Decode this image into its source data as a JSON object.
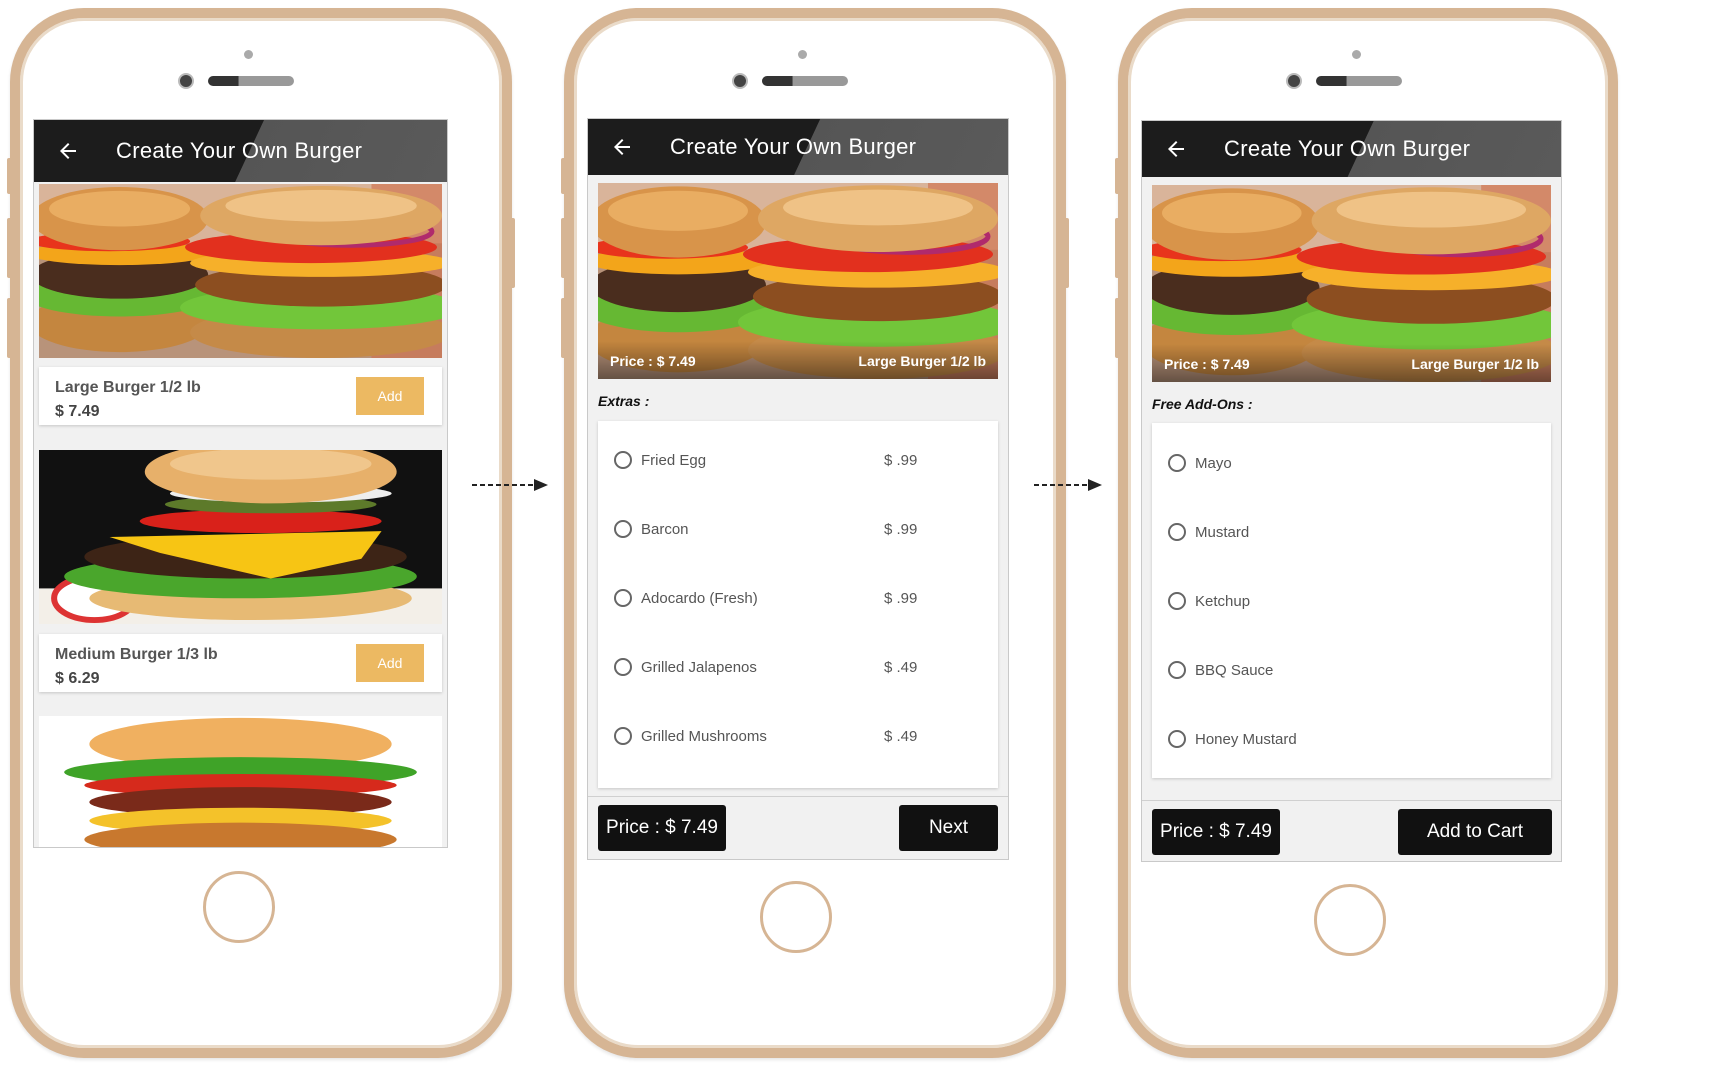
{
  "app_title": "Create Your Own Burger",
  "screen1": {
    "items": [
      {
        "name": "Large Burger 1/2 lb",
        "price": "$ 7.49",
        "add_label": "Add"
      },
      {
        "name": "Medium Burger 1/3 lb",
        "price": "$ 6.29",
        "add_label": "Add"
      }
    ]
  },
  "screen2": {
    "overlay_price": "Price : $ 7.49",
    "overlay_name": "Large Burger 1/2 lb",
    "section_label": "Extras :",
    "options": [
      {
        "label": "Fried Egg",
        "cost": "$ .99"
      },
      {
        "label": "Barcon",
        "cost": "$ .99"
      },
      {
        "label": "Adocardo (Fresh)",
        "cost": "$ .99"
      },
      {
        "label": "Grilled Jalapenos",
        "cost": "$ .49"
      },
      {
        "label": "Grilled Mushrooms",
        "cost": "$ .49"
      }
    ],
    "price_button": "Price : $ 7.49",
    "next_button": "Next"
  },
  "screen3": {
    "overlay_price": "Price : $ 7.49",
    "overlay_name": "Large Burger 1/2 lb",
    "section_label": "Free Add-Ons :",
    "options": [
      {
        "label": "Mayo"
      },
      {
        "label": "Mustard"
      },
      {
        "label": "Ketchup"
      },
      {
        "label": "BBQ Sauce"
      },
      {
        "label": "Honey Mustard"
      }
    ],
    "price_button": "Price : $ 7.49",
    "cart_button": "Add to Cart"
  },
  "colors": {
    "phone_frame": "#d6b594",
    "add_button": "#ecb962",
    "appbar_dark": "#1c1c1c",
    "button_dark": "#111111"
  },
  "icons": [
    "back-arrow-icon",
    "radio-unchecked-icon",
    "home-button",
    "flow-arrow-icon"
  ]
}
